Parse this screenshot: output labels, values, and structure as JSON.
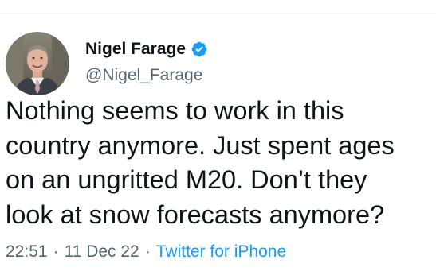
{
  "tweet": {
    "author": {
      "display_name": "Nigel Farage",
      "handle": "@Nigel_Farage",
      "verified": true,
      "verified_icon": "verified-badge-icon",
      "avatar_icon": "profile-photo"
    },
    "text": "Nothing seems to work in this\ncountry anymore. Just spent ages\non an ungritted M20. Don’t they\nlook at snow forecasts anymore?",
    "time": "22:51",
    "separator": "·",
    "date": "11 Dec 22",
    "source": "Twitter for iPhone"
  },
  "colors": {
    "text_primary": "#0f1419",
    "text_secondary": "#536471",
    "accent": "#1d9bf0"
  }
}
